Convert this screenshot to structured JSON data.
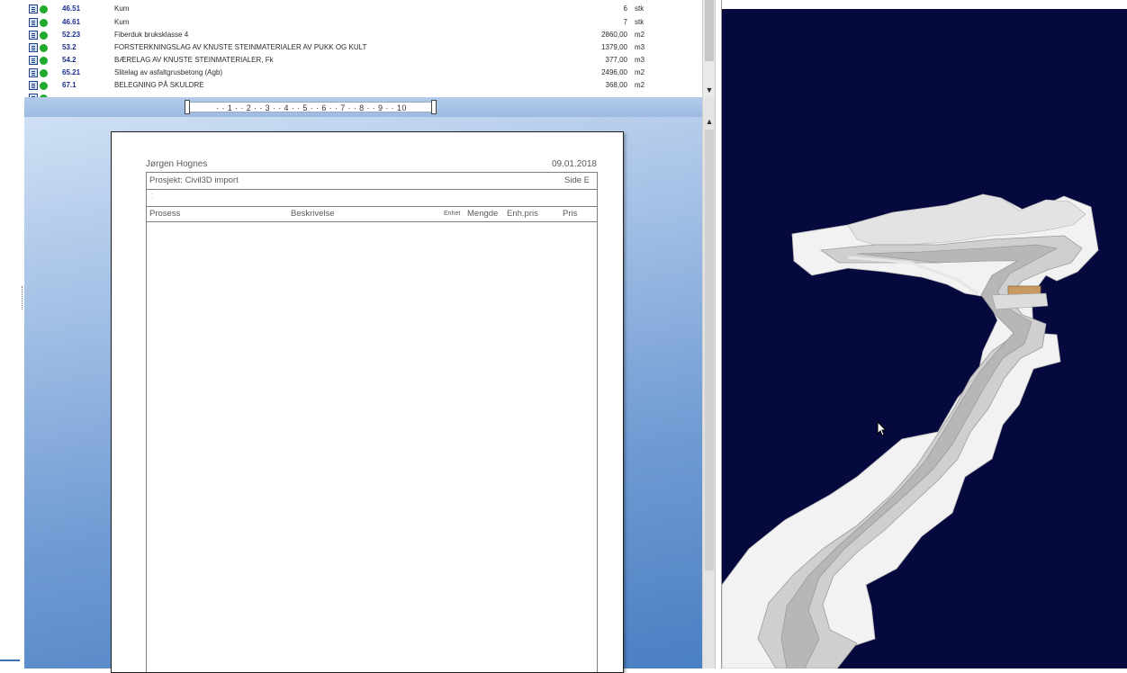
{
  "item_list": {
    "rows": [
      {
        "code": "46.51",
        "description": "Kum",
        "quantity": "6",
        "unit": "stk"
      },
      {
        "code": "46.61",
        "description": "Kum",
        "quantity": "7",
        "unit": "stk"
      },
      {
        "code": "52.23",
        "description": "Fiberduk bruksklasse 4",
        "quantity": "2860,00",
        "unit": "m2"
      },
      {
        "code": "53.2",
        "description": "FORSTERKNINGSLAG AV KNUSTE STEINMATERIALER AV PUKK OG KULT",
        "quantity": "1379,00",
        "unit": "m3"
      },
      {
        "code": "54.2",
        "description": "BÆRELAG AV KNUSTE STEINMATERIALER, Fk",
        "quantity": "377,00",
        "unit": "m3"
      },
      {
        "code": "65.21",
        "description": "Slitelag av asfaltgrusbetong (Agb)",
        "quantity": "2496,00",
        "unit": "m2"
      },
      {
        "code": "67.1",
        "description": "BELEGNING PÅ SKULDRE",
        "quantity": "368,00",
        "unit": "m2"
      }
    ],
    "scroll_down_icon": "▼"
  },
  "ruler": {
    "text": "· · 1 · · 2 · · 3 · · 4 · · 5 · · 6 · · 7 · · 8 · · 9 · · 10"
  },
  "document": {
    "author": "Jørgen Hognes",
    "date": "09.01.2018",
    "project_label": "Prosjekt: Civil3D import",
    "side_label": "Side E",
    "blank_row_mark": ":",
    "columns": {
      "prosess": "Prosess",
      "beskrivelse": "Beskrivelse",
      "enhet": "Enhet",
      "mengde": "Mengde",
      "enh_pris": "Enh.pris",
      "pris": "Pris"
    },
    "scroll_up_icon": "▲"
  },
  "colors": {
    "code_text": "#1a2f8f",
    "status_dot": "#1faa2e",
    "viewport_bg": "#06093e"
  }
}
